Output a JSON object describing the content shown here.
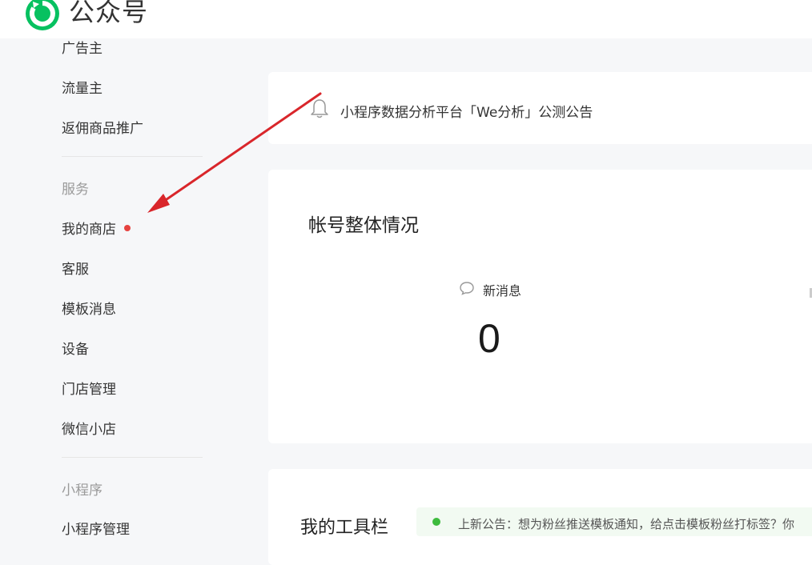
{
  "header": {
    "brand": "公众号"
  },
  "sidebar": {
    "items_top": [
      "广告主",
      "流量主",
      "返佣商品推广"
    ],
    "group_service": "服务",
    "service_items": [
      "我的商店",
      "客服",
      "模板消息",
      "设备",
      "门店管理",
      "微信小店"
    ],
    "group_miniprogram": "小程序",
    "miniprogram_items": [
      "小程序管理"
    ]
  },
  "notice": {
    "text": "小程序数据分析平台「We分析」公测公告"
  },
  "overview": {
    "title": "帐号整体情况",
    "new_messages_label": "新消息",
    "new_messages_count": "0"
  },
  "tools": {
    "title": "我的工具栏",
    "tip": "上新公告：想为粉丝推送模板通知，给点击模板粉丝打标签？你"
  },
  "colors": {
    "brand_green": "#07c160",
    "badge_red": "#e64340",
    "arrow_red": "#d9262b"
  }
}
